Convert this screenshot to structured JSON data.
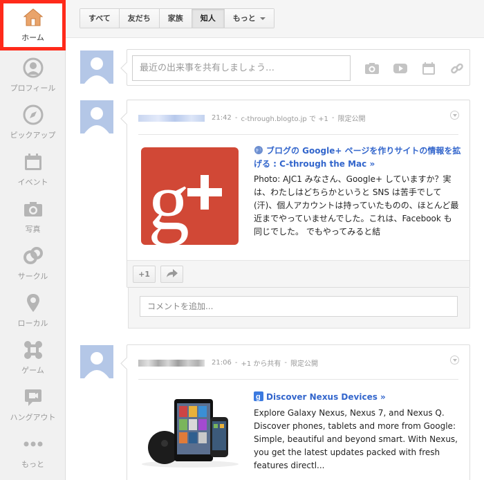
{
  "sidebar": {
    "items": [
      {
        "label": "ホーム",
        "icon": "home-icon",
        "active": true
      },
      {
        "label": "プロフィール",
        "icon": "profile-icon"
      },
      {
        "label": "ピックアップ",
        "icon": "compass-icon"
      },
      {
        "label": "イベント",
        "icon": "calendar-icon"
      },
      {
        "label": "写真",
        "icon": "camera-icon"
      },
      {
        "label": "サークル",
        "icon": "circles-icon"
      },
      {
        "label": "ローカル",
        "icon": "map-pin-icon"
      },
      {
        "label": "ゲーム",
        "icon": "game-icon"
      },
      {
        "label": "ハングアウト",
        "icon": "video-chat-icon"
      },
      {
        "label": "もっと",
        "icon": "more-dots-icon"
      }
    ]
  },
  "filters": {
    "items": [
      "すべて",
      "友だち",
      "家族",
      "知人",
      "もっと"
    ],
    "active": "知人"
  },
  "sharebox": {
    "placeholder": "最近の出来事を共有しましょう…",
    "icons": [
      "photo-icon",
      "video-icon",
      "event-icon",
      "link-icon"
    ]
  },
  "posts": [
    {
      "time": "21:42",
      "via": "c-through.blogto.jp で +1",
      "visibility": "限定公開",
      "link_title": "ブログの Google+ ページを作りサイトの情報を拡げる : C-through the Mac »",
      "body": "Photo: AJC1 みなさん、Google+ していますか？実は、わたしはどちらかというと SNS は苦手でして (汗)、個人アカウントは持っていたものの、ほとんど最近までやっていませんでした。これは、Facebook も同じでした。 でもやってみると結",
      "plus_label": "+1",
      "comment_placeholder": "コメントを追加..."
    },
    {
      "time": "21:06",
      "via": "+1 から共有",
      "visibility": "限定公開",
      "link_title": "Discover Nexus Devices »",
      "body": "Explore Galaxy Nexus, Nexus 7, and Nexus Q. Discover phones, tablets and more from Google: Simple, beautiful and beyond smart. With Nexus, you get the latest updates packed with fresh features directl..."
    }
  ],
  "colors": {
    "active_outline": "#ff2a1a",
    "link": "#3366cc",
    "gplus_red": "#d14836",
    "avatar_blue": "#b4c7e7"
  }
}
